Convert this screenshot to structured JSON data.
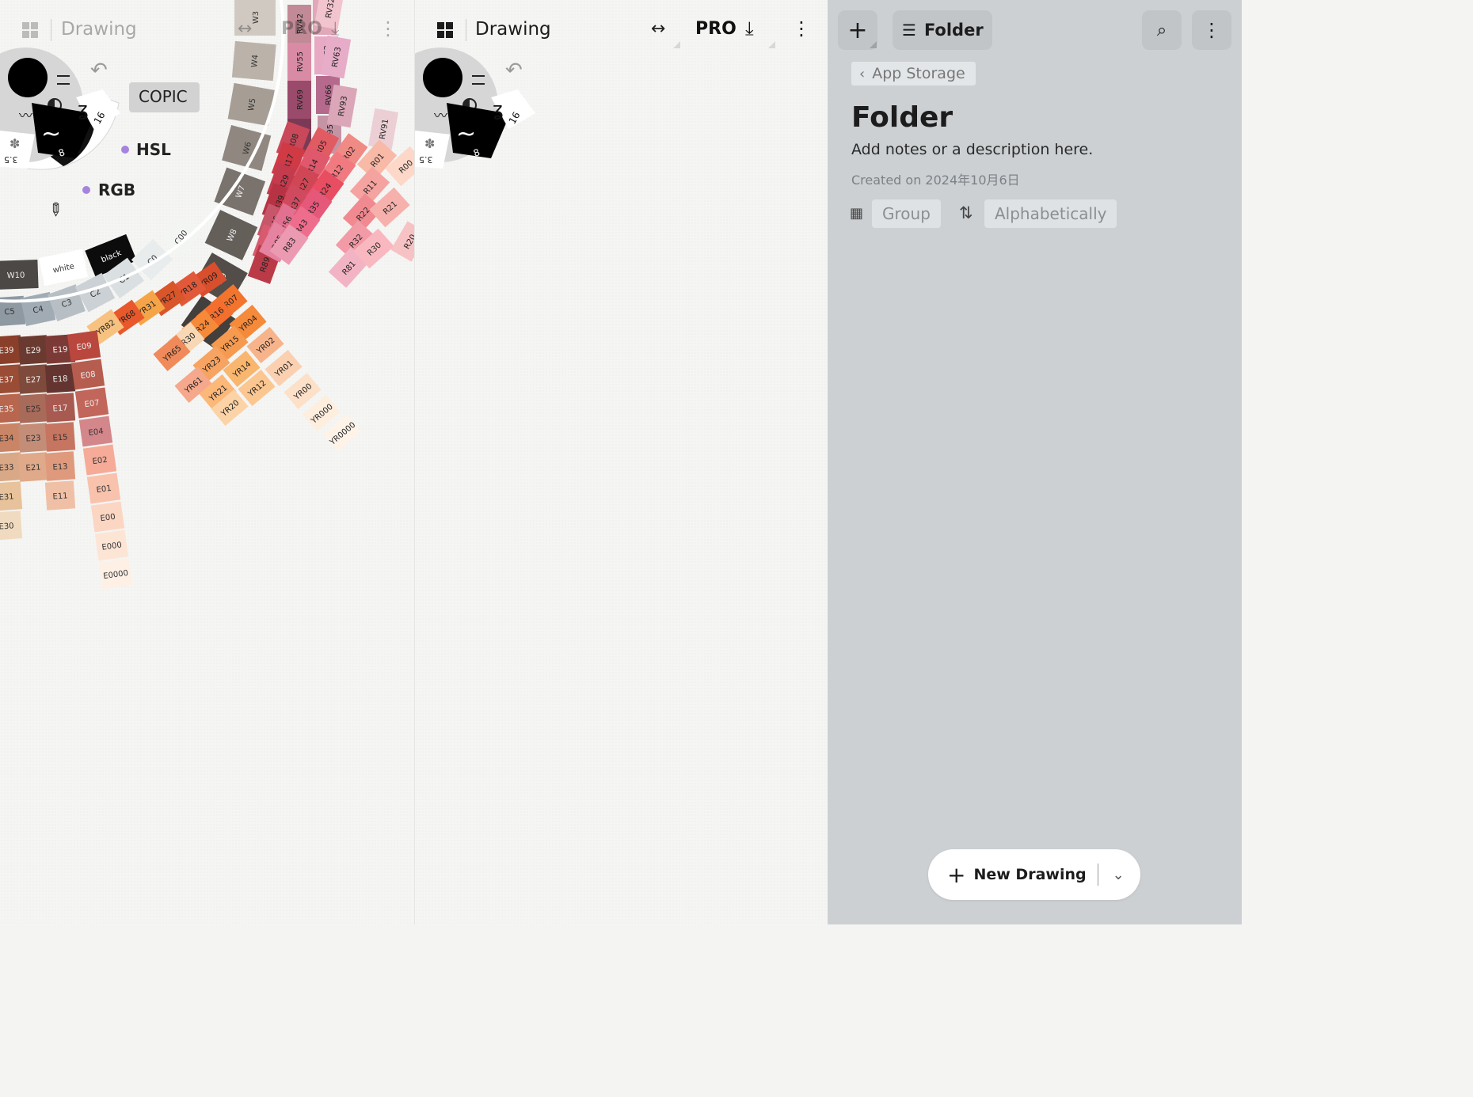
{
  "left_panel": {
    "title": "Drawing",
    "pro_label": "PRO",
    "mode_label": "COPIC",
    "hsl_label": "HSL",
    "rgb_label": "RGB",
    "brush_size_label": "16",
    "brush_opacity_label": "8",
    "brush_small_label": "3.5"
  },
  "middle_panel": {
    "title": "Drawing",
    "pro_label": "PRO",
    "brush_size_label": "16",
    "brush_opacity_label": "8",
    "brush_small_label": "3.5"
  },
  "sidebar": {
    "folder_button_label": "Folder",
    "breadcrumb": "App Storage",
    "title": "Folder",
    "description": "Add notes or a description here.",
    "created": "Created on 2024年10月6日",
    "group_label": "Group",
    "sort_label": "Alphabetically",
    "new_drawing_label": "New Drawing"
  },
  "swatches": {
    "warm_grays": [
      "W3",
      "W4",
      "W5",
      "W6",
      "W7",
      "W8",
      "W9",
      "W10"
    ],
    "neutral_row": [
      "W10",
      "white",
      "black"
    ],
    "cool_grays": [
      "C5",
      "C4",
      "C3",
      "C2",
      "C1",
      "C0",
      "C00"
    ],
    "rv_row1": [
      "RV42",
      "RV55",
      "RV69",
      "RV99"
    ],
    "rv_row2": [
      "RV34",
      "RV52",
      "RV66",
      "RV95"
    ],
    "rv_row3": [
      "RV32",
      "RV63",
      "RV93"
    ],
    "rv_row4": [
      "RV91"
    ],
    "r_row1": [
      "R08",
      "R17",
      "R29",
      "R39",
      "R46",
      "R59",
      "R89"
    ],
    "r_row2": [
      "R05",
      "R14",
      "R27",
      "R37",
      "R56",
      "R85"
    ],
    "r_row3": [
      "R02",
      "R12",
      "R24",
      "R35",
      "R43",
      "R83"
    ],
    "r_row4": [
      "R01",
      "R11",
      "R22",
      "R32",
      "R81"
    ],
    "r_row5": [
      "R00",
      "R21",
      "R30"
    ],
    "r_row6": [
      "R20"
    ],
    "yr_row1": [
      "YR09",
      "YR18",
      "YR27",
      "YR31",
      "YR68",
      "YR82"
    ],
    "yr_row2": [
      "YR07",
      "YR16",
      "YR24",
      "YR30",
      "YR65"
    ],
    "yr_row3": [
      "YR04",
      "YR15",
      "YR23",
      "YR61"
    ],
    "yr_row4": [
      "YR02",
      "YR14",
      "YR21"
    ],
    "yr_row5": [
      "YR01",
      "YR12",
      "YR20"
    ],
    "yr_row6": [
      "YR00"
    ],
    "yr_row7": [
      "YR000"
    ],
    "yr_row8": [
      "YR0000"
    ],
    "e_col1": [
      "E39",
      "E37",
      "E35",
      "E34",
      "E33",
      "E31",
      "E30"
    ],
    "e_col2": [
      "E29",
      "E27",
      "E25",
      "E23",
      "E21"
    ],
    "e_col3": [
      "E19",
      "E18",
      "E17",
      "E15",
      "E13",
      "E11"
    ],
    "e_col4": [
      "E09",
      "E08",
      "E07",
      "E04",
      "E02",
      "E01",
      "E00",
      "E000",
      "E0000"
    ]
  }
}
